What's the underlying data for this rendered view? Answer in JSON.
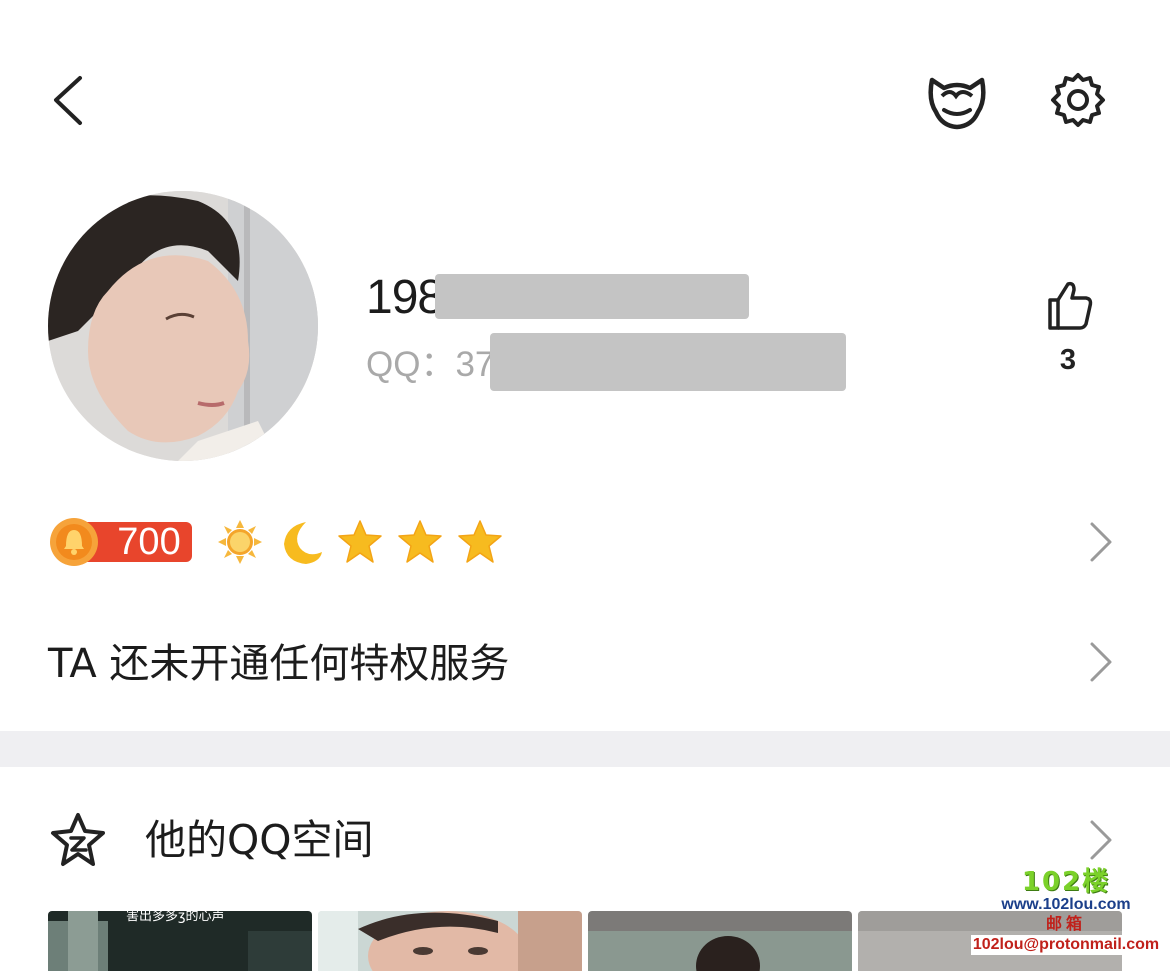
{
  "header": {
    "back_icon": "chevron-left-icon",
    "pet_icon": "cat-face-icon",
    "settings_icon": "gear-icon"
  },
  "profile": {
    "nickname_prefix": "198",
    "qq_label": "QQ：",
    "qq_prefix": "37",
    "like_icon": "thumbs-up-icon",
    "like_count": "3"
  },
  "level": {
    "badge_value": "700",
    "icons": [
      "sun-icon",
      "moon-icon",
      "star-icon",
      "star-icon",
      "star-icon"
    ]
  },
  "privilege": {
    "text": "TA 还未开通任何特权服务"
  },
  "qzone": {
    "icon": "qzone-star-icon",
    "label": "他的QQ空间",
    "thumb_caption": "害出多多ʒ的心声"
  },
  "watermark": {
    "logo": "102楼",
    "url": "www.102lou.com",
    "mail_label": "邮箱",
    "mail": "102lou@protonmail.com"
  },
  "colors": {
    "divider": "#efeff2",
    "badge_red": "#e8452c",
    "coin_orange": "#f28a1d",
    "star_yellow": "#f7bb1f",
    "secondary_text": "#a9a9a9"
  }
}
